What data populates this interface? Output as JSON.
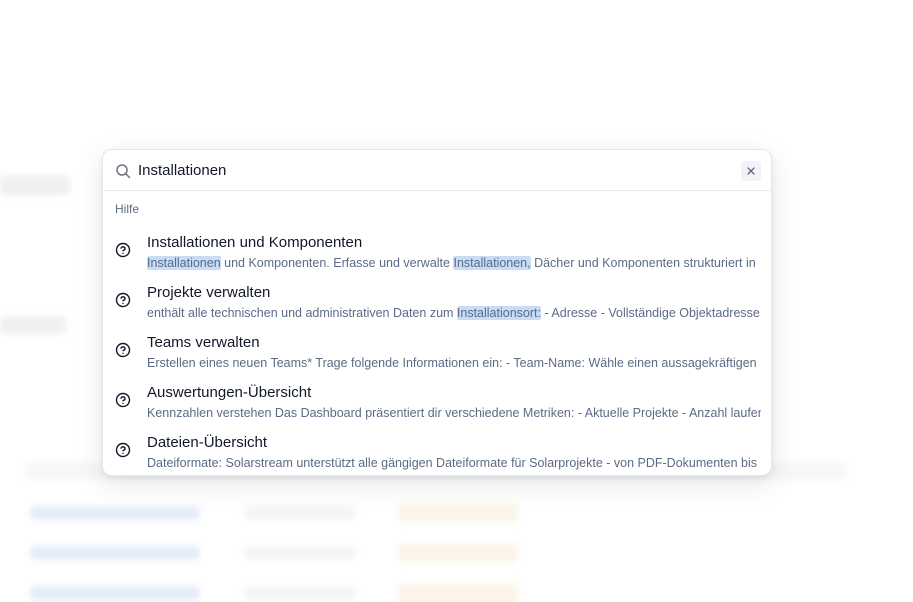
{
  "search": {
    "value": "Installationen",
    "placeholder": ""
  },
  "group_label": "Hilfe",
  "results": [
    {
      "title": "Installationen und Komponenten",
      "desc_parts": [
        "",
        "Installationen",
        " und Komponenten. Erfasse und verwalte ",
        "Installationen,",
        " Dächer und Komponenten strukturiert in"
      ]
    },
    {
      "title": "Projekte verwalten",
      "desc_parts": [
        "enthält alle technischen und administrativen Daten zum ",
        "Installationsort:",
        " - Adresse - Vollständige Objektadresse"
      ]
    },
    {
      "title": "Teams verwalten",
      "desc_parts": [
        "Erstellen eines neuen Teams* Trage folgende Informationen ein: - Team-Name: Wähle einen aussagekräftigen Namen"
      ]
    },
    {
      "title": "Auswertungen-Übersicht",
      "desc_parts": [
        "Kennzahlen verstehen Das Dashboard präsentiert dir verschiedene Metriken: - Aktuelle Projekte - Anzahl laufender Projekte"
      ]
    },
    {
      "title": "Dateien-Übersicht",
      "desc_parts": [
        "Dateiformate: Solarstream unterstützt alle gängigen Dateiformate für Solarprojekte - von PDF-Dokumenten bis"
      ]
    }
  ],
  "icons": {
    "search": "search-icon",
    "clear": "close-icon",
    "result": "help-circle-icon"
  },
  "colors": {
    "highlight": "#c9dcf5",
    "text_primary": "#111827",
    "text_secondary": "#5b6b85"
  }
}
